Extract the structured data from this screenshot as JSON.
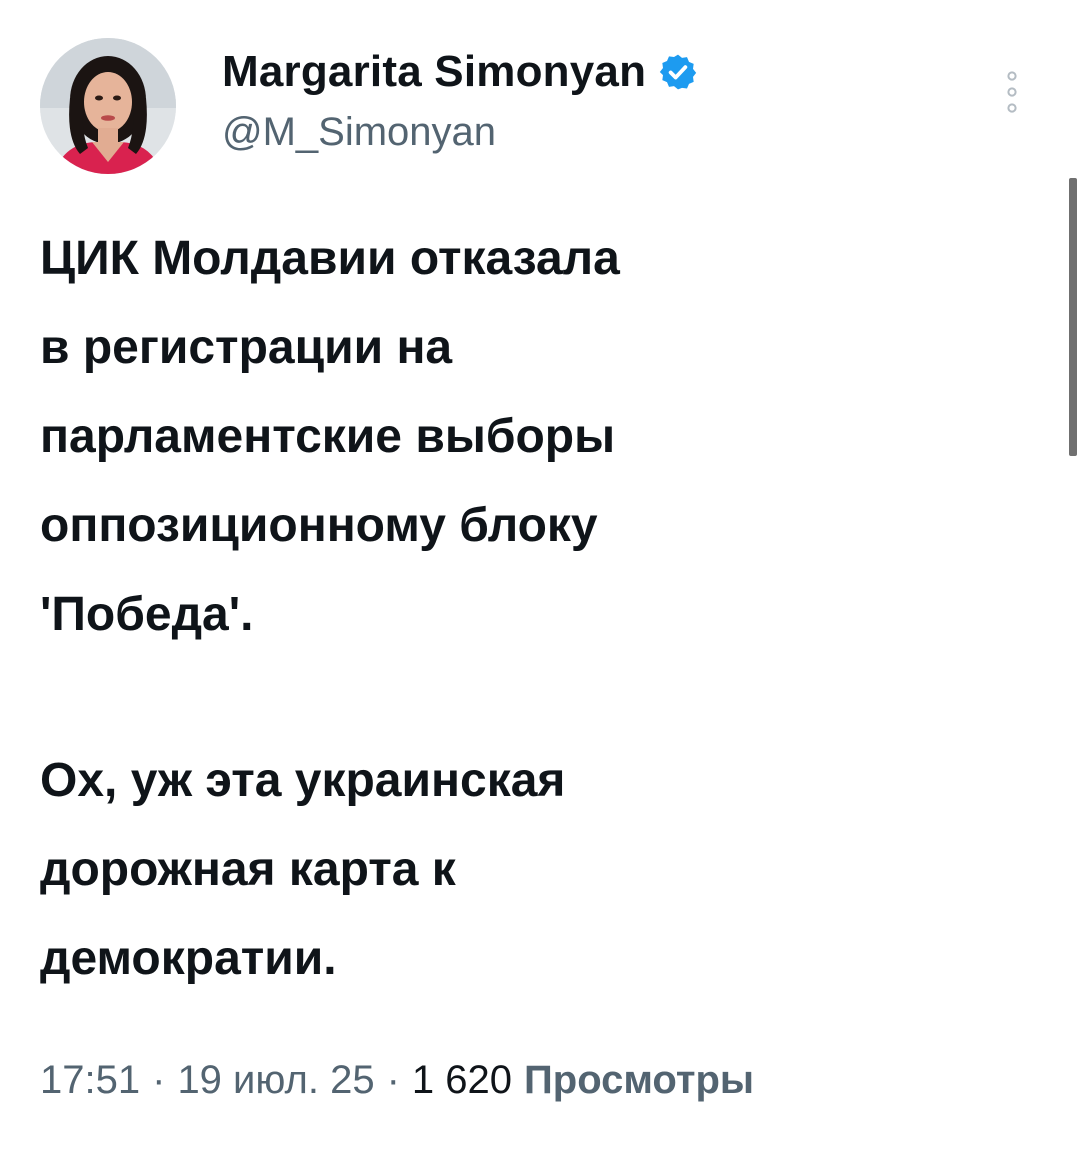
{
  "author": {
    "display_name": "Margarita Simonyan",
    "handle": "@M_Simonyan",
    "verified": true,
    "verified_badge_color": "#1d9bf0"
  },
  "icons": {
    "verified": "verified-badge-icon",
    "more": "more-options-icon"
  },
  "tweet": {
    "paragraph_1": "ЦИК Молдавии отказала\nв регистрации на\nпарламентские выборы\nоппозиционному блоку\n'Победа'.",
    "paragraph_2": "Ох, уж эта украинская\nдорожная карта к\nдемократии."
  },
  "meta": {
    "time": "17:51",
    "separator_1": "·",
    "date": "19 июл. 25",
    "separator_2": "·",
    "views_count": "1 620",
    "views_label": "Просмотры"
  },
  "colors": {
    "text_primary": "#0f1419",
    "text_secondary": "#536471",
    "background": "#ffffff",
    "avatar_accent": "#d9224f"
  }
}
